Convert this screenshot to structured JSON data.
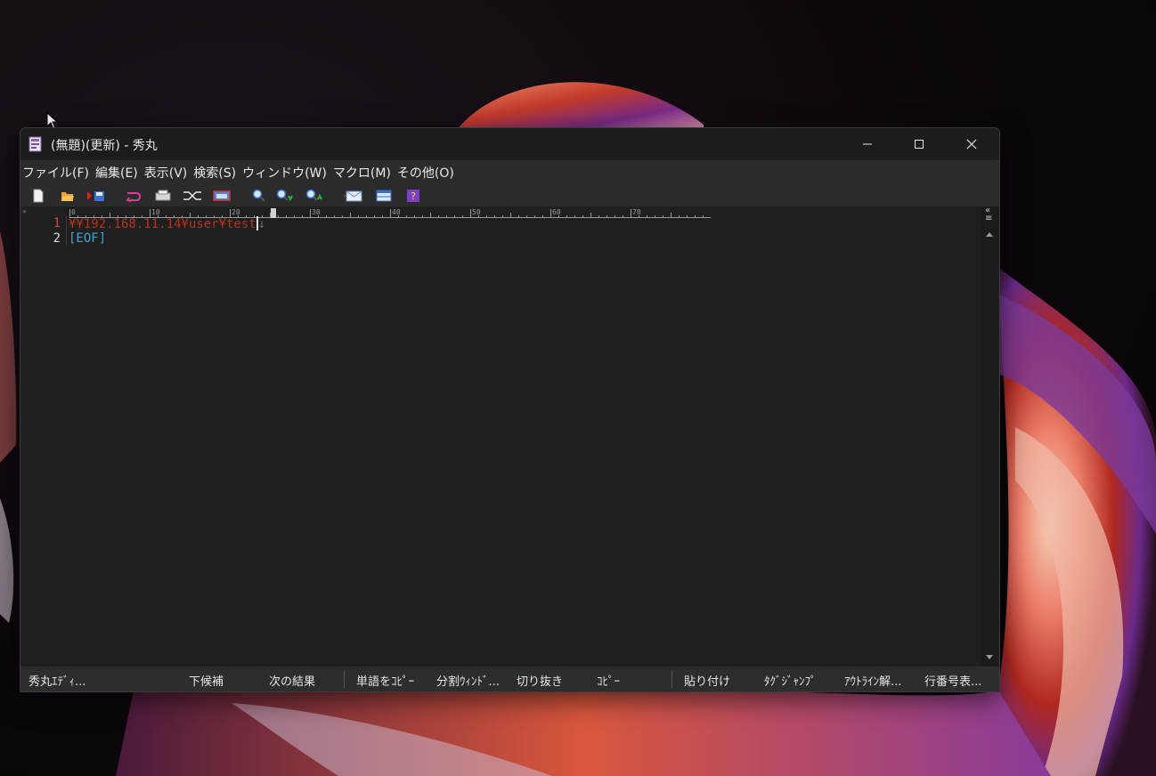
{
  "window": {
    "title": "(無題)(更新) - 秀丸"
  },
  "menu": [
    {
      "label": "ファイル(F)"
    },
    {
      "label": "編集(E)"
    },
    {
      "label": "表示(V)"
    },
    {
      "label": "検索(S)"
    },
    {
      "label": "ウィンドウ(W)"
    },
    {
      "label": "マクロ(M)"
    },
    {
      "label": "その他(O)"
    }
  ],
  "toolbar": {
    "icons": [
      "new-file-icon",
      "open-folder-icon",
      "save-icon",
      "undo-icon",
      "print-icon",
      "shuffle-icon",
      "window-icon",
      "search-icon",
      "search-down-icon",
      "search-up-icon",
      "mail-icon",
      "window-split-icon",
      "help-icon"
    ]
  },
  "ruler": {
    "marker": "»",
    "labels": [
      "0",
      "10",
      "20",
      "30",
      "40",
      "50",
      "60",
      "70"
    ]
  },
  "editor": {
    "lines": [
      {
        "number": "1",
        "text": "¥¥192.168.11.14¥user¥test",
        "end_mark": "↓"
      },
      {
        "number": "2",
        "text": "[EOF]"
      }
    ]
  },
  "scrollbar": {
    "top_symbols": "«",
    "list_symbol": "≡"
  },
  "statusbar": {
    "items": [
      {
        "label": "秀丸ｴﾃﾞｨ..."
      },
      {
        "label": "下候補"
      },
      {
        "label": "次の結果"
      },
      {
        "label": "単語をｺﾋﾟｰ"
      },
      {
        "label": "分割ｳｨﾝﾄﾞ..."
      },
      {
        "label": "切り抜き"
      },
      {
        "label": "ｺﾋﾟｰ"
      },
      {
        "label": "貼り付け"
      },
      {
        "label": "ﾀｸﾞｼﾞｬﾝﾌﾟ"
      },
      {
        "label": "ｱｳﾄﾗｲﾝ解..."
      },
      {
        "label": "行番号表..."
      }
    ]
  },
  "colors": {
    "line1_text": "#b8321e",
    "eof_text": "#3ea8d6",
    "line_number_active": "#d04a3a",
    "line_number": "#d9d9d9"
  }
}
